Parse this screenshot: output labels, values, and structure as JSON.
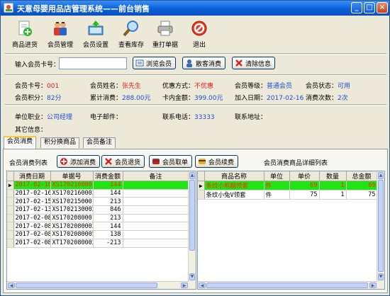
{
  "window": {
    "title": "天意母婴用品店管理系统——前台销售"
  },
  "toolbar": {
    "items": [
      {
        "label": "商品进货",
        "icon": "add-document-icon"
      },
      {
        "label": "会员管理",
        "icon": "members-icon"
      },
      {
        "label": "会员设置",
        "icon": "member-settings-icon"
      },
      {
        "label": "查看库存",
        "icon": "magnifier-icon"
      },
      {
        "label": "重打单据",
        "icon": "printer-icon"
      },
      {
        "label": "退出",
        "icon": "exit-icon"
      }
    ]
  },
  "search": {
    "label": "输入会员卡号：",
    "value": "",
    "browse_button": "浏览会员",
    "walkin_button": "散客消费",
    "clear_button": "清除信息"
  },
  "member": {
    "card_no_label": "会员卡号：",
    "card_no": "001",
    "name_label": "会员姓名：",
    "name": "张先生",
    "discount_label": "优惠方式：",
    "discount": "不优惠",
    "level_label": "会员等级：",
    "level": "普通会员",
    "status_label": "会员状态：",
    "status": "可用",
    "points_label": "会员积分：",
    "points": "82分",
    "total_spent_label": "累计消费：",
    "total_spent": "288.00元",
    "balance_label": "卡内金额：",
    "balance": "399.00元",
    "join_date_label": "加入日期：",
    "join_date": "2017-02-16",
    "visits_label": "消费次数：",
    "visits": "2次",
    "job_label": "单位职业：",
    "job": "公司经理",
    "email_label": "电子邮件：",
    "email": "",
    "phone_label": "联系电话：",
    "phone": "33333",
    "address_label": "联系地址：",
    "address": "",
    "other_label": "其它信息：",
    "other": ""
  },
  "tabs": [
    {
      "label": "会员消费",
      "active": true
    },
    {
      "label": "积分换商品",
      "active": false
    },
    {
      "label": "会员备注",
      "active": false
    }
  ],
  "panel": {
    "list_title": "会员消费列表",
    "add_button": "添加消费",
    "refund_button": "会员退货",
    "withdraw_button": "会员取单",
    "renew_button": "会员续费",
    "detail_title": "会员消费商品详细列表"
  },
  "consumption_table": {
    "columns": [
      "消费日期",
      "单据号",
      "消费金额",
      "备注"
    ],
    "rows": [
      [
        "2017-02-16",
        "XS1702160001",
        "144",
        ""
      ],
      [
        "2017-02-16",
        "XS1702160002",
        "144",
        ""
      ],
      [
        "2017-02-15",
        "XS1702150001",
        "213",
        ""
      ],
      [
        "2017-02-13",
        "XS1702130002",
        "846",
        ""
      ],
      [
        "2017-02-08",
        "XS1702080001",
        "213",
        ""
      ],
      [
        "2017-02-08",
        "XS1702080002",
        "144",
        ""
      ],
      [
        "2017-02-08",
        "XS1702080005",
        "138",
        ""
      ],
      [
        "2017-02-08",
        "XT1702080002",
        "-213",
        ""
      ]
    ],
    "selected_index": 0
  },
  "detail_table": {
    "columns": [
      "商品名称",
      "单位",
      "单价",
      "数量",
      "总金额"
    ],
    "rows": [
      [
        "条纹小熊翻领套",
        "件",
        "69",
        "1",
        "69"
      ],
      [
        "条纹小兔V领套",
        "件",
        "75",
        "1",
        "75"
      ]
    ],
    "selected_index": 0
  },
  "colors": {
    "selected_row_bg": "#22e414",
    "selected_row_text": "#ff2a00",
    "value_blue": "#1d4bd8",
    "value_red": "#e02020"
  }
}
